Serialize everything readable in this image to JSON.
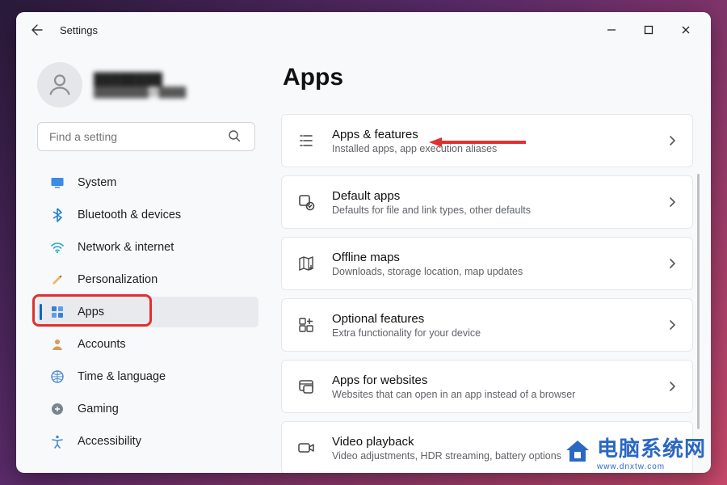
{
  "window": {
    "title": "Settings",
    "page_heading": "Apps"
  },
  "account": {
    "display_name": "████████",
    "email": "████████@████"
  },
  "search": {
    "placeholder": "Find a setting"
  },
  "sidebar": {
    "items": [
      {
        "id": "system",
        "label": "System"
      },
      {
        "id": "bluetooth",
        "label": "Bluetooth & devices"
      },
      {
        "id": "network",
        "label": "Network & internet"
      },
      {
        "id": "personalization",
        "label": "Personalization"
      },
      {
        "id": "apps",
        "label": "Apps"
      },
      {
        "id": "accounts",
        "label": "Accounts"
      },
      {
        "id": "time",
        "label": "Time & language"
      },
      {
        "id": "gaming",
        "label": "Gaming"
      },
      {
        "id": "accessibility",
        "label": "Accessibility"
      }
    ],
    "selected_id": "apps"
  },
  "cards": [
    {
      "id": "apps_features",
      "title": "Apps & features",
      "desc": "Installed apps, app execution aliases"
    },
    {
      "id": "default_apps",
      "title": "Default apps",
      "desc": "Defaults for file and link types, other defaults"
    },
    {
      "id": "offline_maps",
      "title": "Offline maps",
      "desc": "Downloads, storage location, map updates"
    },
    {
      "id": "optional_features",
      "title": "Optional features",
      "desc": "Extra functionality for your device"
    },
    {
      "id": "apps_websites",
      "title": "Apps for websites",
      "desc": "Websites that can open in an app instead of a browser"
    },
    {
      "id": "video_playback",
      "title": "Video playback",
      "desc": "Video adjustments, HDR streaming, battery options"
    }
  ],
  "watermark": {
    "text": "电脑系统网",
    "url": "www.dnxtw.com"
  },
  "colors": {
    "accent": "#0067c0",
    "highlight": "#e03030"
  }
}
